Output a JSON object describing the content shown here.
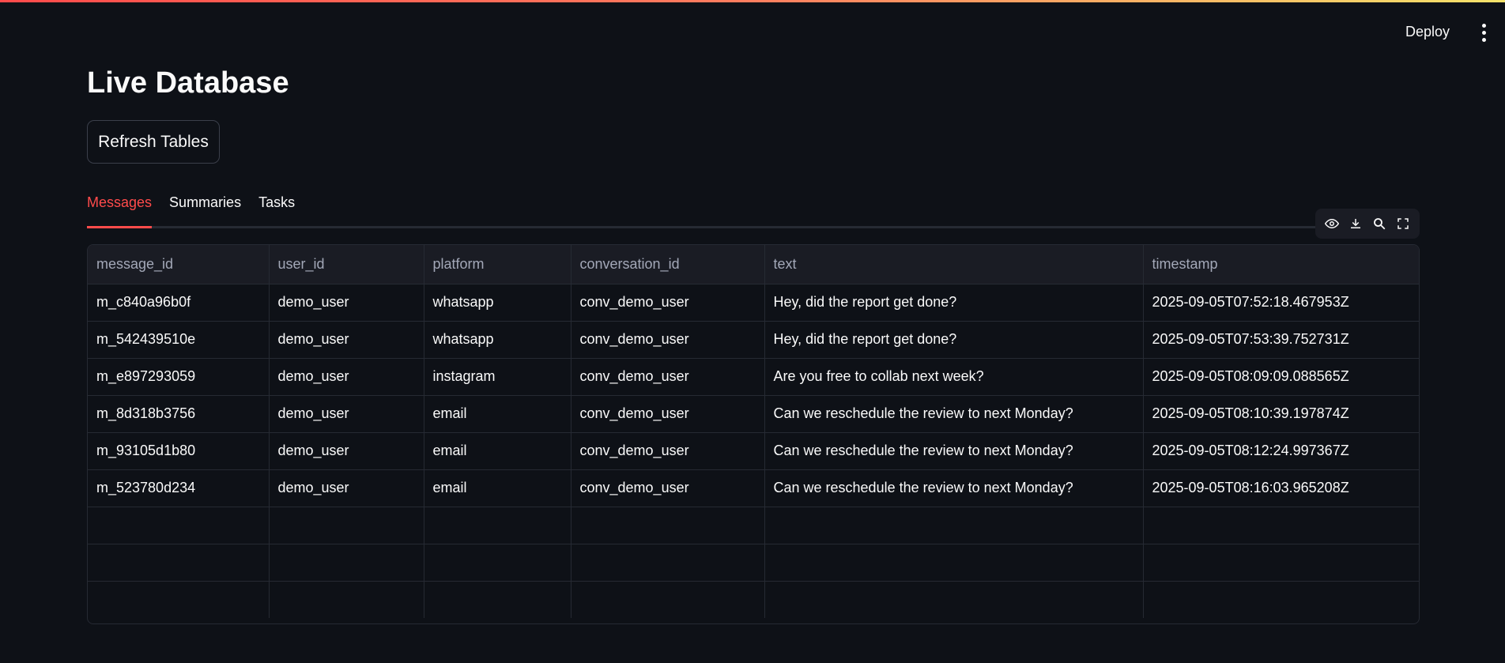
{
  "header": {
    "deploy_label": "Deploy",
    "menu_icon": "vertical-ellipsis-icon"
  },
  "page": {
    "title": "Live Database",
    "refresh_label": "Refresh Tables"
  },
  "tabs": [
    {
      "label": "Messages",
      "active": true
    },
    {
      "label": "Summaries",
      "active": false
    },
    {
      "label": "Tasks",
      "active": false
    }
  ],
  "toolbar": {
    "icons": [
      "eye-icon",
      "download-icon",
      "search-icon",
      "fullscreen-icon"
    ]
  },
  "colors": {
    "background": "#0e1117",
    "accent": "#ff4b4b",
    "header_bg": "#1a1c24",
    "border": "#262a33",
    "muted_text": "#a3a8b8"
  },
  "table": {
    "columns": [
      "message_id",
      "user_id",
      "platform",
      "conversation_id",
      "text",
      "timestamp"
    ],
    "rows": [
      [
        "m_c840a96b0f",
        "demo_user",
        "whatsapp",
        "conv_demo_user",
        "Hey, did the report get done?",
        "2025-09-05T07:52:18.467953Z"
      ],
      [
        "m_542439510e",
        "demo_user",
        "whatsapp",
        "conv_demo_user",
        "Hey, did the report get done?",
        "2025-09-05T07:53:39.752731Z"
      ],
      [
        "m_e897293059",
        "demo_user",
        "instagram",
        "conv_demo_user",
        "Are you free to collab next week?",
        "2025-09-05T08:09:09.088565Z"
      ],
      [
        "m_8d318b3756",
        "demo_user",
        "email",
        "conv_demo_user",
        "Can we reschedule the review to next Monday?",
        "2025-09-05T08:10:39.197874Z"
      ],
      [
        "m_93105d1b80",
        "demo_user",
        "email",
        "conv_demo_user",
        "Can we reschedule the review to next Monday?",
        "2025-09-05T08:12:24.997367Z"
      ],
      [
        "m_523780d234",
        "demo_user",
        "email",
        "conv_demo_user",
        "Can we reschedule the review to next Monday?",
        "2025-09-05T08:16:03.965208Z"
      ],
      [
        "",
        "",
        "",
        "",
        "",
        ""
      ],
      [
        "",
        "",
        "",
        "",
        "",
        ""
      ],
      [
        "",
        "",
        "",
        "",
        "",
        ""
      ]
    ]
  }
}
